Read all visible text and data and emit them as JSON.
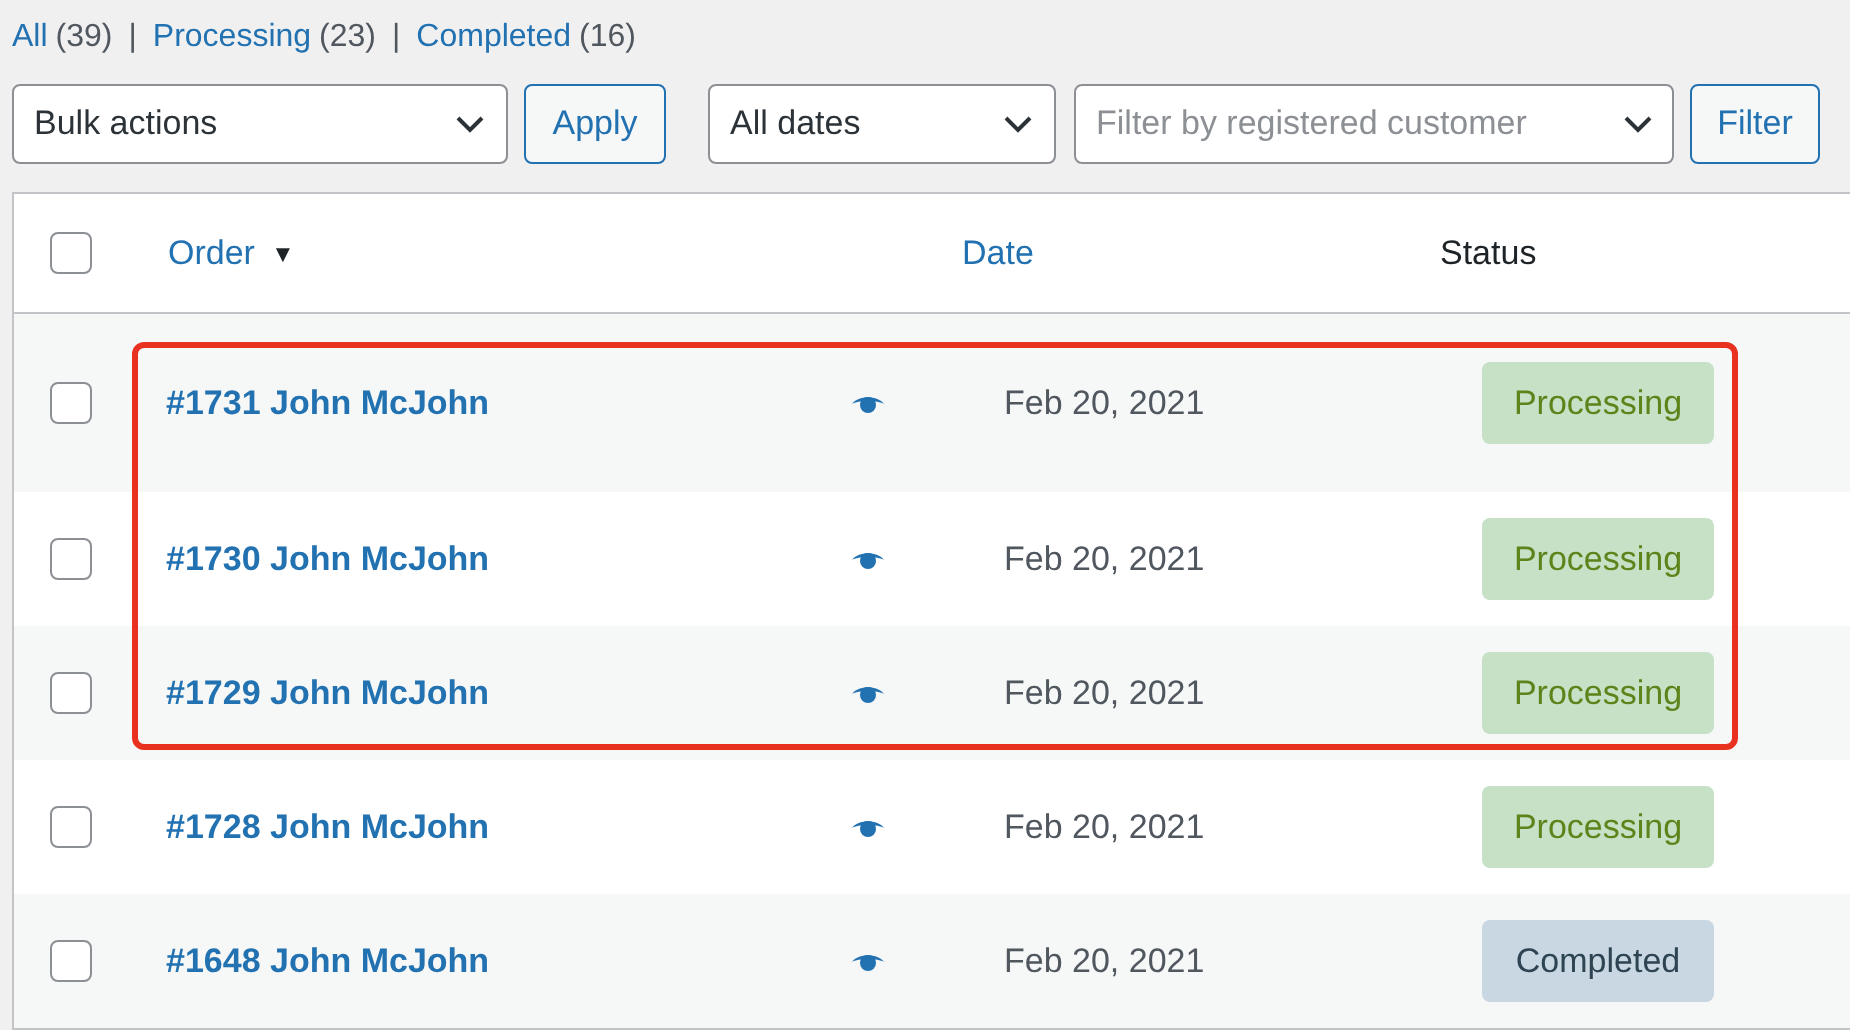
{
  "views": [
    {
      "label": "All",
      "count": "(39)",
      "selected": false
    },
    {
      "label": "Processing",
      "count": "(23)",
      "selected": false
    },
    {
      "label": "Completed",
      "count": "(16)",
      "selected": false
    }
  ],
  "separator": "|",
  "toolbar": {
    "bulk_actions": "Bulk actions",
    "apply": "Apply",
    "dates": "All dates",
    "customer": {
      "placeholder": "Filter by registered customer"
    },
    "filter": "Filter"
  },
  "table": {
    "select_all": {
      "checked": false
    },
    "columns": [
      {
        "label": "Order",
        "sortable": true,
        "sort_icon": "▼"
      },
      {
        "label": "Date",
        "sortable": true
      },
      {
        "label": "Status",
        "sortable": false
      }
    ],
    "rows": [
      {
        "order": "#1731 John McJohn",
        "date": "Feb 20, 2021",
        "status": "Processing",
        "kind": "processing",
        "color": "#c6e1c6",
        "checked": false,
        "highlighted": true
      },
      {
        "order": "#1730 John McJohn",
        "date": "Feb 20, 2021",
        "status": "Processing",
        "kind": "processing",
        "color": "#c6e1c6",
        "checked": false,
        "highlighted": true
      },
      {
        "order": "#1729 John McJohn",
        "date": "Feb 20, 2021",
        "status": "Processing",
        "kind": "processing",
        "color": "#c6e1c6",
        "checked": false,
        "highlighted": true
      },
      {
        "order": "#1728 John McJohn",
        "date": "Feb 20, 2021",
        "status": "Processing",
        "kind": "processing",
        "color": "#c6e1c6",
        "checked": false,
        "highlighted": false
      },
      {
        "order": "#1648 John McJohn",
        "date": "Feb 20, 2021",
        "status": "Completed",
        "kind": "completed",
        "color": "#c8d7e1",
        "checked": false,
        "highlighted": false
      }
    ]
  }
}
